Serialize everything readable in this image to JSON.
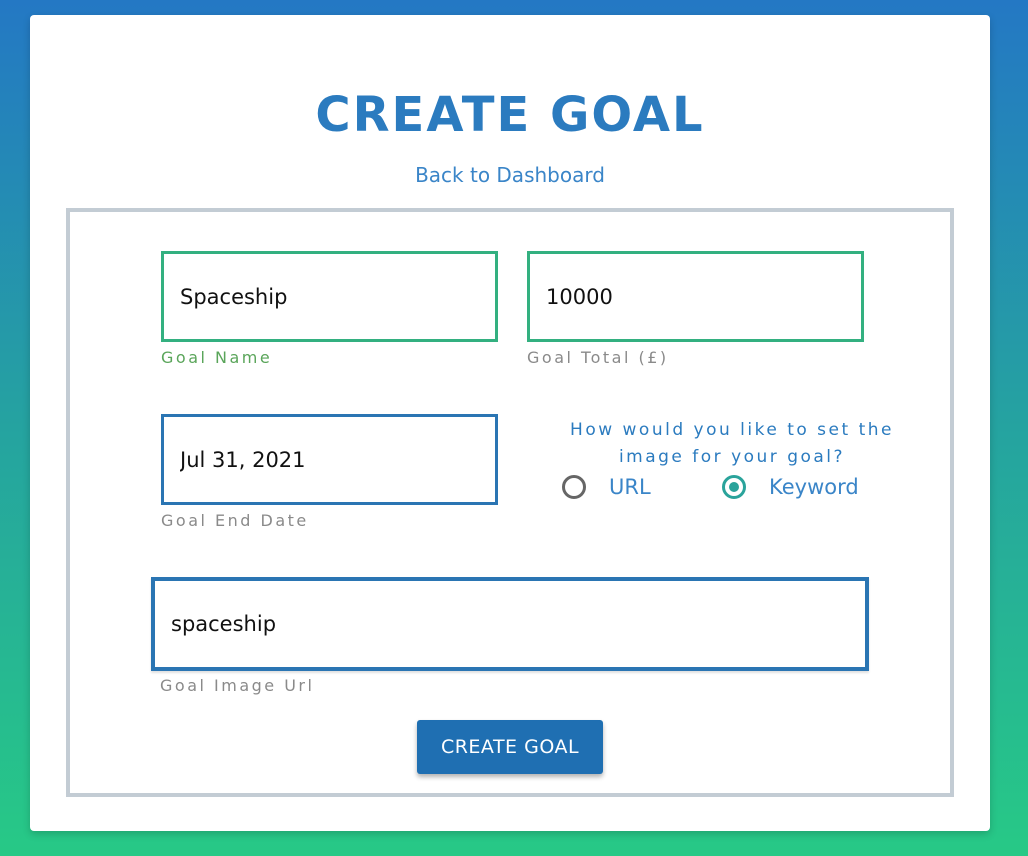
{
  "page": {
    "title": "CREATE GOAL",
    "back_link": "Back to Dashboard"
  },
  "form": {
    "goal_name": {
      "value": "Spaceship",
      "label": "Goal Name"
    },
    "goal_total": {
      "value": "10000",
      "label": "Goal Total (£)"
    },
    "goal_end_date": {
      "value": "Jul 31, 2021",
      "label": "Goal End Date"
    },
    "image_method": {
      "question": "How would you like to set the image for your goal?",
      "options": [
        {
          "label": "URL",
          "checked": false
        },
        {
          "label": "Keyword",
          "checked": true
        }
      ]
    },
    "goal_image": {
      "value": "spaceship",
      "label": "Goal Image Url"
    },
    "submit_label": "CREATE GOAL"
  },
  "colors": {
    "title": "#2b7bbf",
    "active_border": "#33b080",
    "focus_border": "#2a75b3",
    "radio_checked": "#2aa39b",
    "button": "#1f6fb2"
  }
}
